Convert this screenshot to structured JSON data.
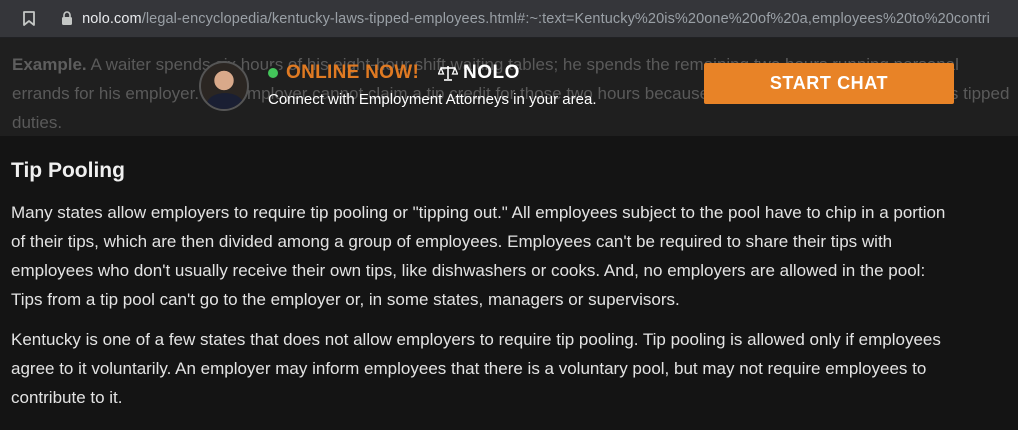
{
  "browser": {
    "url_host": "nolo.com",
    "url_path": "/legal-encyclopedia/kentucky-laws-tipped-employees.html#:~:text=Kentucky%20is%20one%20of%20a,employees%20to%20contri"
  },
  "background": {
    "example_label": "Example.",
    "example_text": "A waiter spends six hours of his eight-hour shift waiting tables; he spends the remaining two hours running personal errands for his employer. The employer cannot claim a tip credit for those two hours because they're not related to the waiter's tipped duties."
  },
  "banner": {
    "status": "ONLINE NOW!",
    "brand": "NOLO",
    "tagline": "Connect with Employment Attorneys in your area.",
    "cta": "START CHAT",
    "colors": {
      "accent": "#e88327",
      "online": "#43c55a"
    }
  },
  "article": {
    "heading": "Tip Pooling",
    "paragraphs": [
      "Many states allow employers to require tip pooling or \"tipping out.\" All employees subject to the pool have to chip in a portion of their tips, which are then divided among a group of employees. Employees can't be required to share their tips with employees who don't usually receive their own tips, like dishwashers or cooks. And, no employers are allowed in the pool: Tips from a tip pool can't go to the employer or, in some states, managers or supervisors.",
      "Kentucky is one of a few states that does not allow employers to require tip pooling. Tip pooling is allowed only if employees agree to it voluntarily. An employer may inform employees that there is a voluntary pool, but may not require employees to contribute to it."
    ]
  }
}
